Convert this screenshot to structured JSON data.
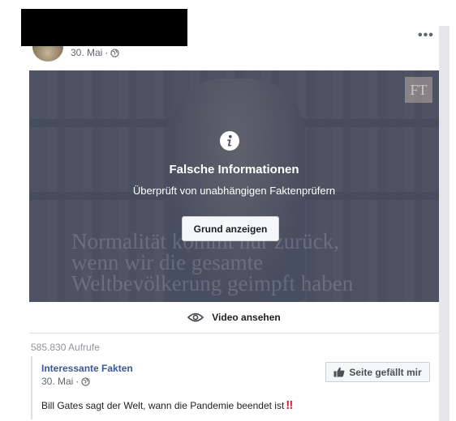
{
  "post": {
    "date": "30. Mai",
    "dot": "·",
    "more_label": "•••"
  },
  "video": {
    "brand_mark": "FT",
    "watermark_lines": [
      "Normalität kommt nur zurück,",
      "wenn wir die gesamte",
      "Weltbevölkerung geimpft haben"
    ],
    "overlay_title": "Falsche Informationen",
    "overlay_subtitle": "Überprüft von unabhängigen Faktenprüfern",
    "reason_button": "Grund anzeigen"
  },
  "watch": {
    "label": "Video ansehen"
  },
  "stats": {
    "views": "585.830 Aufrufe"
  },
  "shared_page": {
    "name": "Interessante Fakten",
    "date": "30. Mai",
    "dot": "·",
    "like_button": "Seite gefällt mir",
    "text": "Bill Gates sagt der Welt, wann die Pandemie beendet ist",
    "emphasis": "‼"
  },
  "colors": {
    "link": "#385898",
    "emphasis": "#e0182f",
    "overlay": "#4b5264"
  }
}
